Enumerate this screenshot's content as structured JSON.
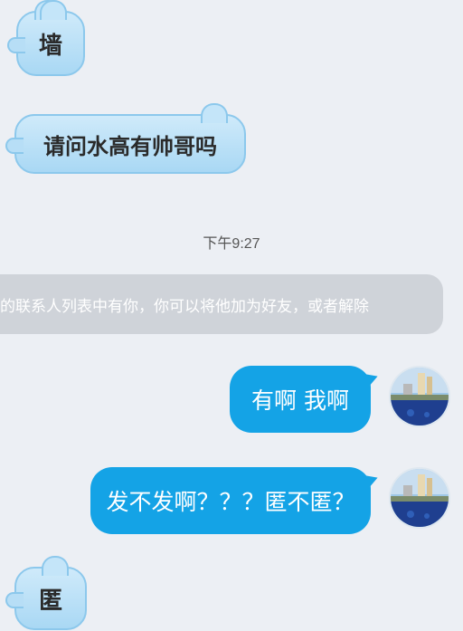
{
  "messages": {
    "m1": "墙",
    "m2": "请问水高有帅哥吗",
    "timestamp": "下午9:27",
    "system": "的联系人列表中有你，你可以将他加为好友，或者解除",
    "m3": "有啊 我啊",
    "m4": "发不发啊？？？匿不匿？",
    "m5": "匿"
  },
  "colors": {
    "sent_bubble": "#14a3e6",
    "received_bubble": "#bfe3f8",
    "background": "#eceff4",
    "system_bar": "#cfd3d9"
  }
}
